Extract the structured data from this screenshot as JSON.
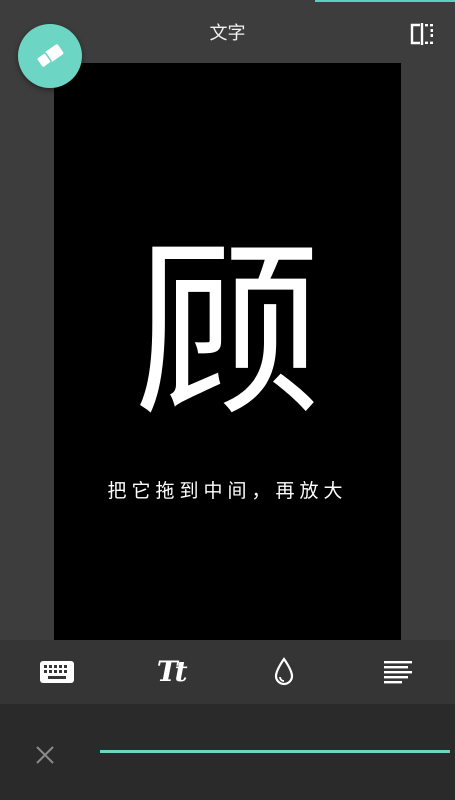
{
  "header": {
    "title": "文字"
  },
  "canvas": {
    "main_character": "顾",
    "hint_text": "把它拖到中间，再放大"
  },
  "toolbar": {
    "tools": [
      {
        "icon": "keyboard-icon"
      },
      {
        "icon": "font-style-icon",
        "glyph": "Tt"
      },
      {
        "icon": "color-drop-icon"
      },
      {
        "icon": "text-align-icon"
      }
    ]
  },
  "bottom": {
    "close_icon": "close-icon",
    "slider_value": 1.0
  },
  "colors": {
    "accent": "#6dd5c4",
    "background": "#3d3d3d",
    "canvas": "#000000",
    "toolbar": "#353535",
    "bottom_bar": "#2a2a2a"
  }
}
